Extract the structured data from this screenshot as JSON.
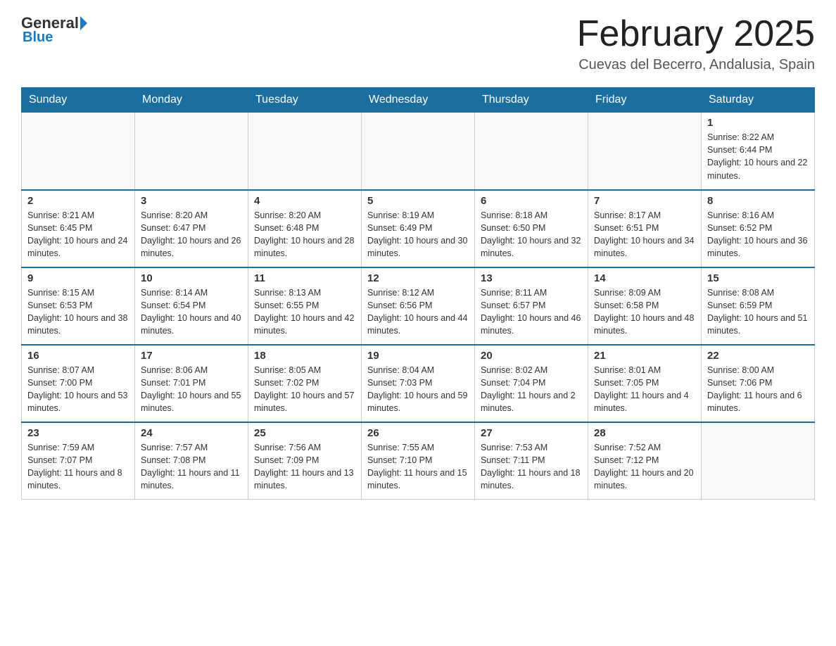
{
  "logo": {
    "general": "General",
    "blue": "Blue",
    "arrow": "▶"
  },
  "header": {
    "title": "February 2025",
    "location": "Cuevas del Becerro, Andalusia, Spain"
  },
  "weekdays": [
    "Sunday",
    "Monday",
    "Tuesday",
    "Wednesday",
    "Thursday",
    "Friday",
    "Saturday"
  ],
  "weeks": [
    [
      {
        "day": "",
        "info": ""
      },
      {
        "day": "",
        "info": ""
      },
      {
        "day": "",
        "info": ""
      },
      {
        "day": "",
        "info": ""
      },
      {
        "day": "",
        "info": ""
      },
      {
        "day": "",
        "info": ""
      },
      {
        "day": "1",
        "info": "Sunrise: 8:22 AM\nSunset: 6:44 PM\nDaylight: 10 hours and 22 minutes."
      }
    ],
    [
      {
        "day": "2",
        "info": "Sunrise: 8:21 AM\nSunset: 6:45 PM\nDaylight: 10 hours and 24 minutes."
      },
      {
        "day": "3",
        "info": "Sunrise: 8:20 AM\nSunset: 6:47 PM\nDaylight: 10 hours and 26 minutes."
      },
      {
        "day": "4",
        "info": "Sunrise: 8:20 AM\nSunset: 6:48 PM\nDaylight: 10 hours and 28 minutes."
      },
      {
        "day": "5",
        "info": "Sunrise: 8:19 AM\nSunset: 6:49 PM\nDaylight: 10 hours and 30 minutes."
      },
      {
        "day": "6",
        "info": "Sunrise: 8:18 AM\nSunset: 6:50 PM\nDaylight: 10 hours and 32 minutes."
      },
      {
        "day": "7",
        "info": "Sunrise: 8:17 AM\nSunset: 6:51 PM\nDaylight: 10 hours and 34 minutes."
      },
      {
        "day": "8",
        "info": "Sunrise: 8:16 AM\nSunset: 6:52 PM\nDaylight: 10 hours and 36 minutes."
      }
    ],
    [
      {
        "day": "9",
        "info": "Sunrise: 8:15 AM\nSunset: 6:53 PM\nDaylight: 10 hours and 38 minutes."
      },
      {
        "day": "10",
        "info": "Sunrise: 8:14 AM\nSunset: 6:54 PM\nDaylight: 10 hours and 40 minutes."
      },
      {
        "day": "11",
        "info": "Sunrise: 8:13 AM\nSunset: 6:55 PM\nDaylight: 10 hours and 42 minutes."
      },
      {
        "day": "12",
        "info": "Sunrise: 8:12 AM\nSunset: 6:56 PM\nDaylight: 10 hours and 44 minutes."
      },
      {
        "day": "13",
        "info": "Sunrise: 8:11 AM\nSunset: 6:57 PM\nDaylight: 10 hours and 46 minutes."
      },
      {
        "day": "14",
        "info": "Sunrise: 8:09 AM\nSunset: 6:58 PM\nDaylight: 10 hours and 48 minutes."
      },
      {
        "day": "15",
        "info": "Sunrise: 8:08 AM\nSunset: 6:59 PM\nDaylight: 10 hours and 51 minutes."
      }
    ],
    [
      {
        "day": "16",
        "info": "Sunrise: 8:07 AM\nSunset: 7:00 PM\nDaylight: 10 hours and 53 minutes."
      },
      {
        "day": "17",
        "info": "Sunrise: 8:06 AM\nSunset: 7:01 PM\nDaylight: 10 hours and 55 minutes."
      },
      {
        "day": "18",
        "info": "Sunrise: 8:05 AM\nSunset: 7:02 PM\nDaylight: 10 hours and 57 minutes."
      },
      {
        "day": "19",
        "info": "Sunrise: 8:04 AM\nSunset: 7:03 PM\nDaylight: 10 hours and 59 minutes."
      },
      {
        "day": "20",
        "info": "Sunrise: 8:02 AM\nSunset: 7:04 PM\nDaylight: 11 hours and 2 minutes."
      },
      {
        "day": "21",
        "info": "Sunrise: 8:01 AM\nSunset: 7:05 PM\nDaylight: 11 hours and 4 minutes."
      },
      {
        "day": "22",
        "info": "Sunrise: 8:00 AM\nSunset: 7:06 PM\nDaylight: 11 hours and 6 minutes."
      }
    ],
    [
      {
        "day": "23",
        "info": "Sunrise: 7:59 AM\nSunset: 7:07 PM\nDaylight: 11 hours and 8 minutes."
      },
      {
        "day": "24",
        "info": "Sunrise: 7:57 AM\nSunset: 7:08 PM\nDaylight: 11 hours and 11 minutes."
      },
      {
        "day": "25",
        "info": "Sunrise: 7:56 AM\nSunset: 7:09 PM\nDaylight: 11 hours and 13 minutes."
      },
      {
        "day": "26",
        "info": "Sunrise: 7:55 AM\nSunset: 7:10 PM\nDaylight: 11 hours and 15 minutes."
      },
      {
        "day": "27",
        "info": "Sunrise: 7:53 AM\nSunset: 7:11 PM\nDaylight: 11 hours and 18 minutes."
      },
      {
        "day": "28",
        "info": "Sunrise: 7:52 AM\nSunset: 7:12 PM\nDaylight: 11 hours and 20 minutes."
      },
      {
        "day": "",
        "info": ""
      }
    ]
  ]
}
